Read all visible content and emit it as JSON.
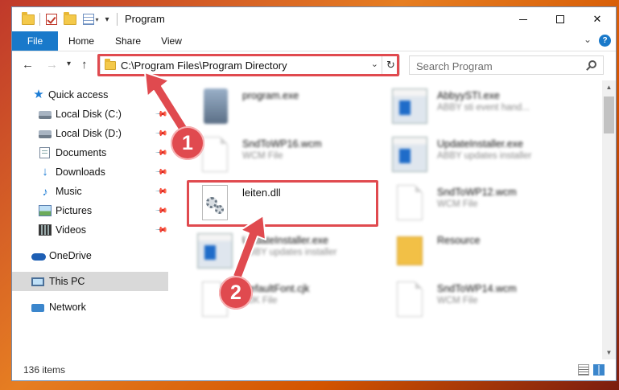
{
  "window": {
    "title": "Program",
    "controls": {
      "minimize": "",
      "maximize": "",
      "close": "✕"
    }
  },
  "ribbon": {
    "tabs": [
      "File",
      "Home",
      "Share",
      "View"
    ],
    "help": "?"
  },
  "nav": {
    "back": "←",
    "forward": "→",
    "recent": "▾",
    "up": "↑",
    "address": "C:\\Program Files\\Program Directory",
    "refresh": "↻",
    "search_placeholder": "Search Program"
  },
  "sidebar": {
    "items": [
      {
        "label": "Quick access",
        "icon": "star-icon"
      },
      {
        "label": "Local Disk (C:)",
        "icon": "disk-icon",
        "pinned": true
      },
      {
        "label": "Local Disk (D:)",
        "icon": "disk-icon",
        "pinned": true
      },
      {
        "label": "Documents",
        "icon": "documents-icon",
        "pinned": true
      },
      {
        "label": "Downloads",
        "icon": "download-icon",
        "pinned": true
      },
      {
        "label": "Music",
        "icon": "music-icon",
        "pinned": true
      },
      {
        "label": "Pictures",
        "icon": "pictures-icon",
        "pinned": true
      },
      {
        "label": "Videos",
        "icon": "videos-icon",
        "pinned": true
      },
      {
        "label": "OneDrive",
        "icon": "onedrive-icon"
      },
      {
        "label": "This PC",
        "icon": "computer-icon",
        "selected": true
      },
      {
        "label": "Network",
        "icon": "network-icon"
      }
    ]
  },
  "files": [
    {
      "name": "program.exe",
      "desc": "",
      "icon": "exe-icon"
    },
    {
      "name": "AbbyySTI.exe",
      "desc": "ABBY sti event hand...",
      "icon": "app-icon"
    },
    {
      "name": "SndToWP16.wcm",
      "desc": "WCM File",
      "icon": "page-icon"
    },
    {
      "name": "UpdateInstaller.exe",
      "desc": "ABBY updates installer",
      "icon": "app-icon"
    },
    {
      "name": "leiten.dll",
      "desc": "",
      "icon": "dll-gear-icon"
    },
    {
      "name": "SndToWP12.wcm",
      "desc": "WCM File",
      "icon": "page-icon"
    },
    {
      "name": "UpdateInstaller.exe",
      "desc": "ABBY updates installer",
      "icon": "app-icon"
    },
    {
      "name": "Resource",
      "desc": "",
      "icon": "folder-icon"
    },
    {
      "name": "DefaultFont.cjk",
      "desc": "CJK File",
      "icon": "page-icon"
    },
    {
      "name": "SndToWP14.wcm",
      "desc": "WCM File",
      "icon": "page-icon"
    }
  ],
  "status": {
    "items": "136 items"
  },
  "annotations": {
    "step1": "1",
    "step2": "2",
    "color": "#e04a4f"
  }
}
